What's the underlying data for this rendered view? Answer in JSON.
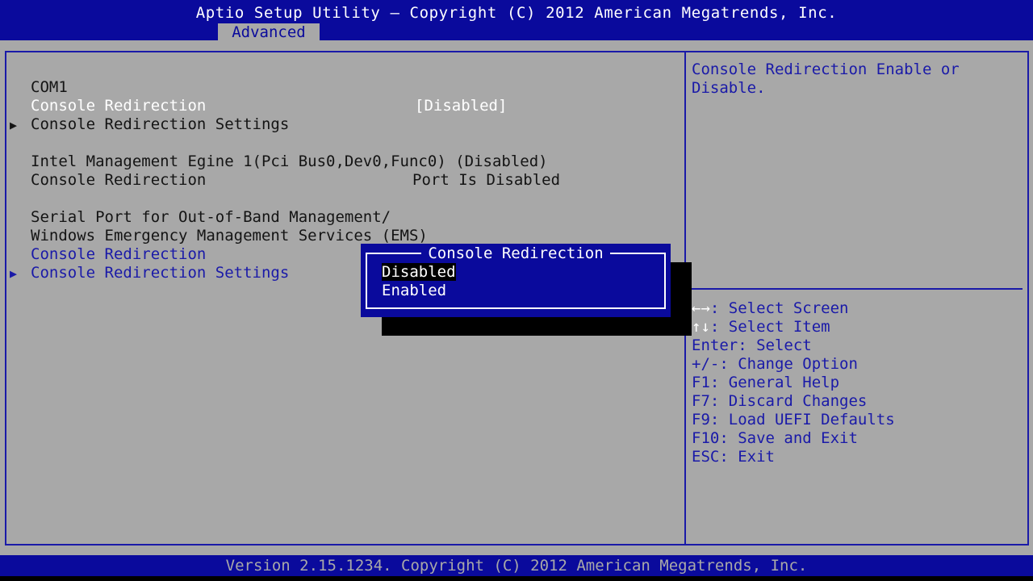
{
  "header": {
    "title": "Aptio Setup Utility – Copyright (C) 2012 American Megatrends, Inc.",
    "active_tab": "Advanced"
  },
  "settings": {
    "section1_title": "COM1",
    "row1_label": "Console Redirection",
    "row1_value": "[Disabled]",
    "row2_label": "Console Redirection Settings",
    "section2_title": "Intel Management Egine 1(Pci Bus0,Dev0,Func0) (Disabled)",
    "row3_label": "Console Redirection",
    "row3_value": "Port Is Disabled",
    "section3_title_line1": "Serial Port for Out-of-Band Management/",
    "section3_title_line2": "Windows Emergency Management Services (EMS)",
    "row4_label": "Console Redirection",
    "row5_label": "Console Redirection Settings"
  },
  "help": {
    "line1": "Console Redirection Enable or",
    "line2": "Disable."
  },
  "keys": [
    "++: Select Screen",
    "↑↓: Select Item",
    "Enter: Select",
    "+/-: Change Option",
    "F1: General Help",
    "F7: Discard Changes",
    "F9: Load UEFI Defaults",
    "F10: Save and Exit",
    "ESC: Exit"
  ],
  "popup": {
    "title": "Console Redirection",
    "options": [
      "Disabled",
      "Enabled"
    ],
    "selected": "Disabled"
  },
  "footer": {
    "text": "Version 2.15.1234. Copyright (C) 2012 American Megatrends, Inc."
  },
  "colors": {
    "bios_blue": "#0a0a9c",
    "bios_gray": "#a8a8a8",
    "text_white": "#ffffff",
    "text_black": "#141414"
  }
}
